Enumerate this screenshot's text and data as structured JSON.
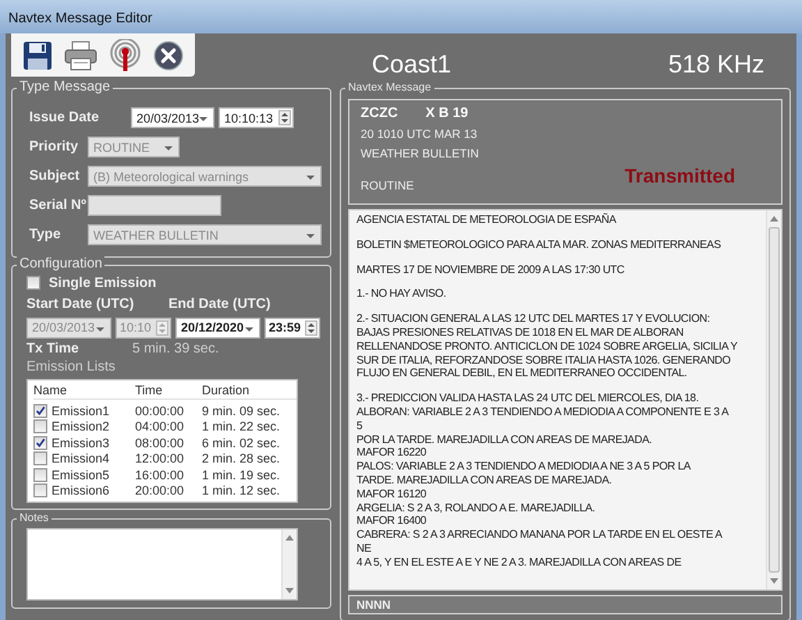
{
  "window": {
    "title": "Navtex Message Editor"
  },
  "toolbar": [
    {
      "kind": "save"
    },
    {
      "kind": "print"
    },
    {
      "kind": "transmit"
    },
    {
      "kind": "close"
    }
  ],
  "station": "Coast1",
  "frequency": "518 KHz",
  "type_message": {
    "title": "Type Message",
    "issue_date": {
      "label": "Issue Date",
      "date": "20/03/2013",
      "time": "10:10:13"
    },
    "fields": [
      {
        "label": "Priority",
        "kind": "dropdown",
        "value": "ROUTINE",
        "disabled": true
      },
      {
        "label": "Subject",
        "kind": "dropdown",
        "value": "(B) Meteorological warnings",
        "disabled": true
      },
      {
        "label": "Serial Nº",
        "kind": "text",
        "disabled": true
      },
      {
        "label": "Type",
        "kind": "dropdown",
        "value": "WEATHER BULLETIN",
        "disabled": true
      }
    ]
  },
  "configuration": {
    "title": "Configuration",
    "single_emission": {
      "label": "Single Emission",
      "checked": false
    },
    "start": {
      "label": "Start Date (UTC)",
      "date": "20/03/2013",
      "time": "10:10",
      "disabled": true
    },
    "end": {
      "label": "End Date (UTC)",
      "date": "20/12/2020",
      "time": "23:59",
      "disabled": false
    },
    "tx_time": {
      "label": "Tx Time",
      "value": "5 min.  39 sec."
    },
    "emission_lists": {
      "title": "Emission Lists",
      "columns": [
        "Name",
        "Time",
        "Duration"
      ],
      "rows": [
        {
          "name": "Emission1",
          "time": "00:00:00",
          "duration": "9 min.  09 sec.",
          "checked": true
        },
        {
          "name": "Emission2",
          "time": "04:00:00",
          "duration": "1 min.  22 sec.",
          "checked": false
        },
        {
          "name": "Emission3",
          "time": "08:00:00",
          "duration": "6 min.  02 sec.",
          "checked": true
        },
        {
          "name": "Emission4",
          "time": "12:00:00",
          "duration": "2 min.  28 sec.",
          "checked": false
        },
        {
          "name": "Emission5",
          "time": "16:00:00",
          "duration": "1 min.  19 sec.",
          "checked": false
        },
        {
          "name": "Emission6",
          "time": "20:00:00",
          "duration": "1 min.  12 sec.",
          "checked": false
        }
      ]
    }
  },
  "notes": {
    "title": "Notes"
  },
  "navtex_message": {
    "title": "Navtex Message",
    "header": {
      "preamble": "ZCZC",
      "id": "X B 19",
      "datetime": "20 1010 UTC MAR 13",
      "type": "WEATHER BULLETIN",
      "priority": "ROUTINE",
      "status": "Transmitted"
    },
    "body": [
      [
        "AGENCIA ESTATAL DE METEOROLOGIA DE ESPAÑA"
      ],
      [
        "BOLETIN $METEOROLOGICO PARA ALTA MAR. ZONAS MEDITERRANEAS"
      ],
      [
        "MARTES 17 DE NOVIEMBRE DE 2009 A LAS 17:30 UTC"
      ],
      [
        "1.- NO HAY AVISO."
      ],
      [
        "2.- SITUACION GENERAL A LAS 12 UTC DEL MARTES 17 Y EVOLUCION:",
        "BAJAS PRESIONES RELATIVAS DE 1018 EN EL MAR DE ALBORAN",
        "RELLENANDOSE PRONTO. ANTICICLON DE 1024 SOBRE ARGELIA, SICILIA Y",
        "SUR DE ITALIA, REFORZANDOSE SOBRE ITALIA HASTA 1026. GENERANDO",
        "FLUJO EN GENERAL DEBIL, EN EL MEDITERRANEO OCCIDENTAL."
      ],
      [
        "3.- PREDICCION VALIDA HASTA LAS 24 UTC DEL MIERCOLES, DIA 18.",
        "ALBORAN: VARIABLE 2 A 3 TENDIENDO A MEDIODIA A COMPONENTE E 3 A",
        "5",
        "POR LA TARDE. MAREJADILLA CON AREAS DE MAREJADA.",
        "MAFOR 16220",
        "PALOS: VARIABLE 2 A 3 TENDIENDO A MEDIODIA A NE 3 A 5 POR LA",
        "TARDE. MAREJADILLA CON AREAS DE MAREJADA.",
        "MAFOR 16120",
        "ARGELIA: S 2 A 3, ROLANDO A E. MAREJADILLA.",
        "MAFOR 16400",
        "CABRERA: S 2 A 3 ARRECIANDO MANANA POR LA TARDE EN EL OESTE A",
        "NE",
        "4 A 5, Y EN EL ESTE A E Y NE 2 A 3. MAREJADILLA CON AREAS DE"
      ]
    ],
    "footer": "NNNN"
  }
}
